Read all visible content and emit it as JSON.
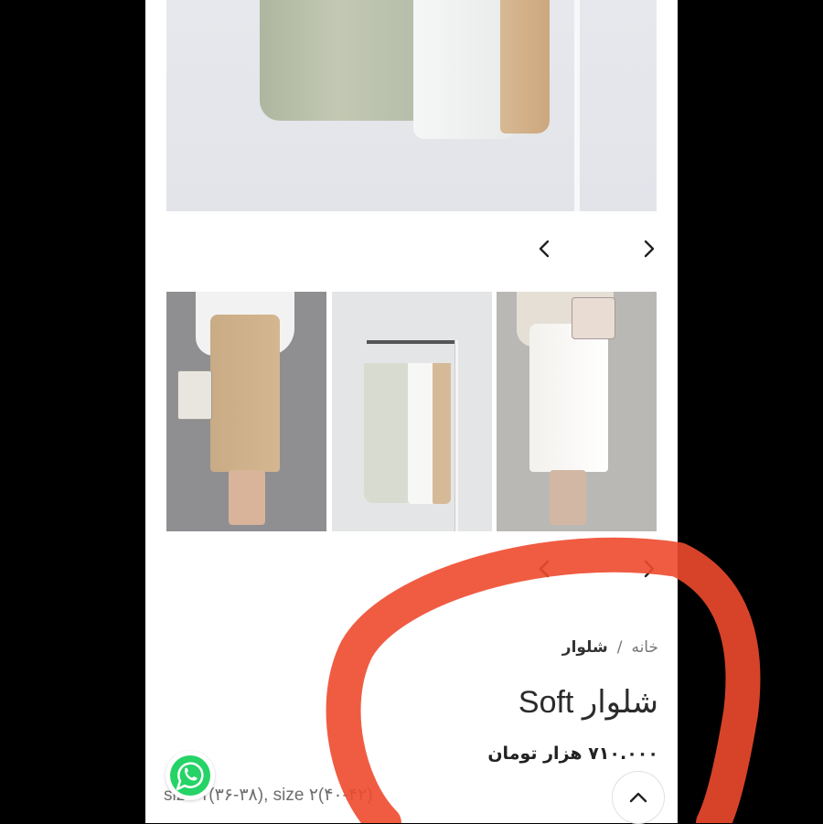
{
  "gallery": {
    "main_image_alt": "pants-on-hanger-photo",
    "prev_icon": "chevron-left-icon",
    "next_icon": "chevron-right-icon",
    "thumbnails": [
      {
        "name": "thumb-beige-model"
      },
      {
        "name": "thumb-hanger-pants"
      },
      {
        "name": "thumb-white-model"
      }
    ]
  },
  "breadcrumb": {
    "home": "خانه",
    "separator": "/",
    "current": "شلوار"
  },
  "product": {
    "title": "شلوار Soft",
    "price": "۷۱۰.۰۰۰ هزار تومان",
    "sizes": "size ۱(۳۶-۳۸), size ۲(۴۰-۴۲)"
  },
  "floating": {
    "whatsapp_icon": "whatsapp-icon",
    "scroll_top_icon": "chevron-up-icon"
  },
  "colors": {
    "page_bg": "#ffffff",
    "side_bg": "#000000",
    "whatsapp_green": "#25d366",
    "annotation_red": "#ee4a2e"
  }
}
